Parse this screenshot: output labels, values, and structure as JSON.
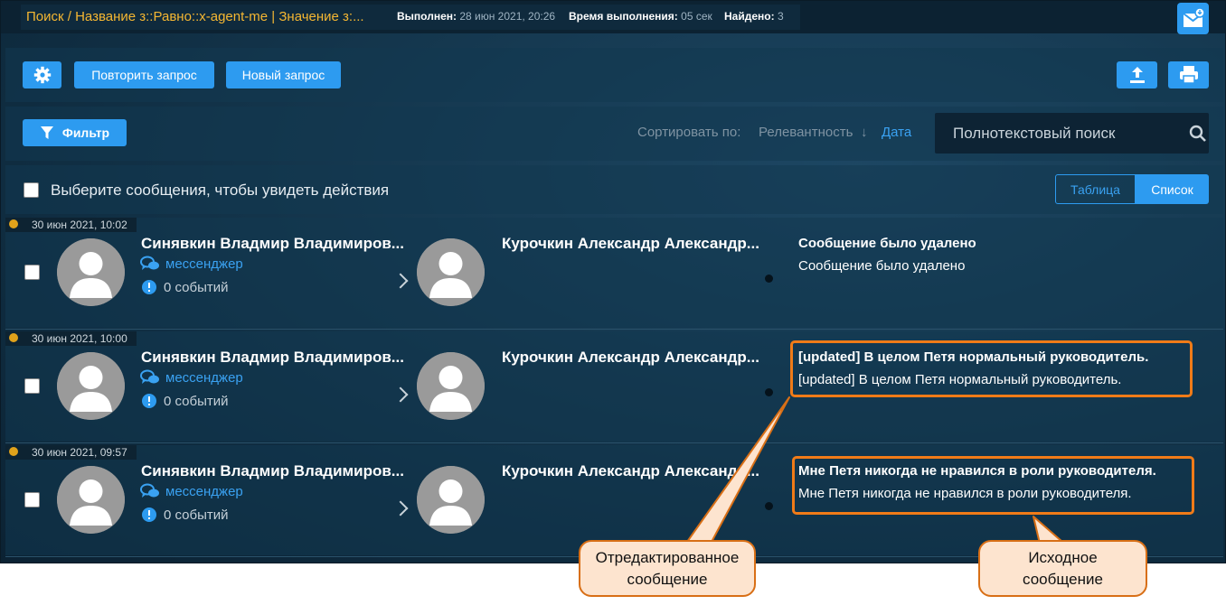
{
  "header": {
    "breadcrumb": "Поиск / Название з::Равно::x-agent-me | Значение з:...",
    "executed_label": "Выполнен:",
    "executed_value": "28 июн 2021, 20:26",
    "duration_label": "Время выполнения:",
    "duration_value": "05 сек",
    "found_label": "Найдено:",
    "found_value": "3"
  },
  "toolbar": {
    "repeat_label": "Повторить запрос",
    "new_label": "Новый запрос",
    "filter_label": "Фильтр"
  },
  "sort": {
    "label": "Сортировать по:",
    "relevance": "Релевантность",
    "relevance_arrow": "↓",
    "date": "Дата"
  },
  "search": {
    "placeholder": "Полнотекстовый поиск"
  },
  "selection": {
    "text": "Выберите сообщения, чтобы увидеть действия"
  },
  "view_toggle": {
    "table": "Таблица",
    "list": "Список"
  },
  "messages": [
    {
      "time": "30 июн 2021, 10:02",
      "sender": "Синявкин Владмир Владимиров...",
      "channel": "мессенджер",
      "events": "0 событий",
      "recipient": "Курочкин Александр Александр...",
      "title": "Сообщение было удалено",
      "text": "Сообщение было удалено"
    },
    {
      "time": "30 июн 2021, 10:00",
      "sender": "Синявкин Владмир Владимиров...",
      "channel": "мессенджер",
      "events": "0 событий",
      "recipient": "Курочкин Александр Александр...",
      "title": "[updated] В целом Петя нормальный руководитель.",
      "text": "[updated] В целом Петя нормальный руководитель."
    },
    {
      "time": "30 июн 2021, 09:57",
      "sender": "Синявкин Владмир Владимиров...",
      "channel": "мессенджер",
      "events": "0 событий",
      "recipient": "Курочкин Александр Александр...",
      "title": "Мне Петя никогда не нравился в роли руководителя.",
      "text": "Мне Петя никогда не нравился в роли руководителя."
    }
  ],
  "callouts": {
    "edited_line1": "Отредактированное",
    "edited_line2": "сообщение",
    "original_line1": "Исходное",
    "original_line2": "сообщение"
  },
  "colors": {
    "accent": "#2d9bf0",
    "breadcrumb": "#f5b732",
    "highlight": "#f07b18",
    "callout_bg": "#fde4cf"
  }
}
